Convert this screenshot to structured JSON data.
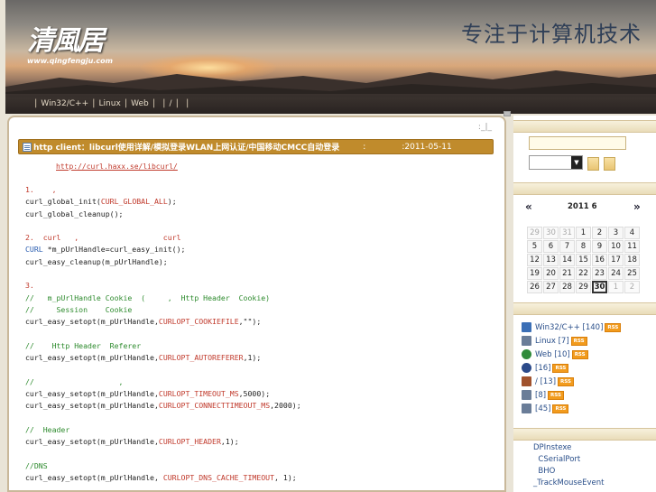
{
  "header": {
    "logo_text": "清風居",
    "logo_url": "www.qingfengju.com",
    "slogan": "专注于计算机技术"
  },
  "nav": {
    "items": [
      "Win32/C++",
      "Linux",
      "Web",
      "",
      "/",
      "",
      ""
    ]
  },
  "main": {
    "top_links": ":_|_",
    "post": {
      "title": "http client：libcurl使用详解/模拟登录WLAN上网认证/中国移动CMCC自动登录",
      "date_label": ":",
      "date": ":2011-05-11",
      "link": "http://curl.haxx.se/libcurl/"
    },
    "code": [
      [
        {
          "c": "c-red",
          "t": "1.    ,"
        }
      ],
      [
        {
          "c": "c-dark",
          "t": "curl_global_init("
        },
        {
          "c": "c-red",
          "t": "CURL_GLOBAL_ALL"
        },
        {
          "c": "c-dark",
          "t": ");"
        }
      ],
      [
        {
          "c": "c-dark",
          "t": "curl_global_cleanup();"
        }
      ],
      [
        {
          "c": "c-dark",
          "t": ""
        }
      ],
      [
        {
          "c": "c-red",
          "t": "2.  curl   ,                   curl"
        }
      ],
      [
        {
          "c": "c-blue",
          "t": "CURL"
        },
        {
          "c": "c-dark",
          "t": " *m_pUrlHandle=curl_easy_init();"
        }
      ],
      [
        {
          "c": "c-dark",
          "t": "curl_easy_cleanup(m_pUrlHandle);"
        }
      ],
      [
        {
          "c": "c-dark",
          "t": ""
        }
      ],
      [
        {
          "c": "c-red",
          "t": "3."
        }
      ],
      [
        {
          "c": "c-green",
          "t": "//   m_pUrlHandle Cookie  (     ,  Http Header  Cookie)"
        }
      ],
      [
        {
          "c": "c-green",
          "t": "//     Session    Cookie"
        }
      ],
      [
        {
          "c": "c-dark",
          "t": "curl_easy_setopt(m_pUrlHandle,"
        },
        {
          "c": "c-red",
          "t": "CURLOPT_COOKIEFILE"
        },
        {
          "c": "c-dark",
          "t": ",\"\");"
        }
      ],
      [
        {
          "c": "c-dark",
          "t": ""
        }
      ],
      [
        {
          "c": "c-green",
          "t": "//    Http Header  Referer"
        }
      ],
      [
        {
          "c": "c-dark",
          "t": "curl_easy_setopt(m_pUrlHandle,"
        },
        {
          "c": "c-red",
          "t": "CURLOPT_AUTOREFERER"
        },
        {
          "c": "c-dark",
          "t": ",1);"
        }
      ],
      [
        {
          "c": "c-dark",
          "t": ""
        }
      ],
      [
        {
          "c": "c-green",
          "t": "//                   ,"
        }
      ],
      [
        {
          "c": "c-dark",
          "t": "curl_easy_setopt(m_pUrlHandle,"
        },
        {
          "c": "c-red",
          "t": "CURLOPT_TIMEOUT_MS"
        },
        {
          "c": "c-dark",
          "t": ",5000);"
        }
      ],
      [
        {
          "c": "c-dark",
          "t": "curl_easy_setopt(m_pUrlHandle,"
        },
        {
          "c": "c-red",
          "t": "CURLOPT_CONNECTTIMEOUT_MS"
        },
        {
          "c": "c-dark",
          "t": ",2000);"
        }
      ],
      [
        {
          "c": "c-dark",
          "t": ""
        }
      ],
      [
        {
          "c": "c-green",
          "t": "//  Header"
        }
      ],
      [
        {
          "c": "c-dark",
          "t": "curl_easy_setopt(m_pUrlHandle,"
        },
        {
          "c": "c-red",
          "t": "CURLOPT_HEADER"
        },
        {
          "c": "c-dark",
          "t": ",1);"
        }
      ],
      [
        {
          "c": "c-dark",
          "t": ""
        }
      ],
      [
        {
          "c": "c-green",
          "t": "//DNS"
        }
      ],
      [
        {
          "c": "c-dark",
          "t": "curl_easy_setopt(m_pUrlHandle, "
        },
        {
          "c": "c-red",
          "t": "CURLOPT_DNS_CACHE_TIMEOUT"
        },
        {
          "c": "c-dark",
          "t": ", 1);"
        }
      ]
    ]
  },
  "sidebar": {
    "search_value": "",
    "select_value": "",
    "calendar": {
      "prev": "«",
      "next": "»",
      "title": "2011 6",
      "days": [
        {
          "d": "29",
          "o": true
        },
        {
          "d": "30",
          "o": true
        },
        {
          "d": "31",
          "o": true
        },
        {
          "d": "1"
        },
        {
          "d": "2"
        },
        {
          "d": "3"
        },
        {
          "d": "4"
        },
        {
          "d": "5"
        },
        {
          "d": "6"
        },
        {
          "d": "7"
        },
        {
          "d": "8"
        },
        {
          "d": "9"
        },
        {
          "d": "10"
        },
        {
          "d": "11"
        },
        {
          "d": "12"
        },
        {
          "d": "13"
        },
        {
          "d": "14"
        },
        {
          "d": "15"
        },
        {
          "d": "16"
        },
        {
          "d": "17"
        },
        {
          "d": "18"
        },
        {
          "d": "19"
        },
        {
          "d": "20"
        },
        {
          "d": "21"
        },
        {
          "d": "22"
        },
        {
          "d": "23"
        },
        {
          "d": "24"
        },
        {
          "d": "25"
        },
        {
          "d": "26"
        },
        {
          "d": "27"
        },
        {
          "d": "28"
        },
        {
          "d": "29"
        },
        {
          "d": "30",
          "t": true
        },
        {
          "d": "1",
          "o": true
        },
        {
          "d": "2",
          "o": true
        }
      ]
    },
    "categories": [
      {
        "label": "Win32/C++ [140]",
        "icon": "windows-icon",
        "color": "#3b6fb6"
      },
      {
        "label": "Linux [7]",
        "icon": "document-icon",
        "color": "#6a7d98"
      },
      {
        "label": "Web  [10]",
        "icon": "globe-icon",
        "color": "#2f8a3a"
      },
      {
        "label": "   [16]",
        "icon": "penguin-icon",
        "color": "#2b4a8a"
      },
      {
        "label": "  /  [13]",
        "icon": "cup-icon",
        "color": "#a0522d"
      },
      {
        "label": "  [8]",
        "icon": "page-icon",
        "color": "#6a7d98"
      },
      {
        "label": "  [45]",
        "icon": "page-icon",
        "color": "#6a7d98"
      }
    ],
    "rss_label": "RSS",
    "links": [
      "DPInstexe",
      "  CSerialPort",
      "  BHO",
      "_TrackMouseEvent"
    ]
  }
}
